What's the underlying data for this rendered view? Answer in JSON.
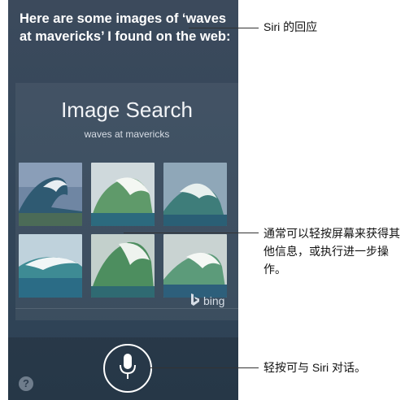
{
  "siri_response": "Here are some images of ‘waves at mavericks’ I found on the web:",
  "card": {
    "title": "Image Search",
    "query": "waves at mavericks",
    "provider": "bing"
  },
  "thumbnails": [
    {
      "name": "wave-image-1"
    },
    {
      "name": "wave-image-2"
    },
    {
      "name": "wave-image-3"
    },
    {
      "name": "wave-image-4"
    },
    {
      "name": "wave-image-5"
    },
    {
      "name": "wave-image-6"
    }
  ],
  "help_label": "?",
  "callouts": {
    "siri_response": "Siri 的回应",
    "tap_images": "通常可以轻按屏幕来获得其他信息，或执行进一步操作。",
    "tap_mic": "轻按可与 Siri 对话。"
  },
  "icons": {
    "mic": "microphone-icon",
    "help": "question-mark-icon",
    "bing": "bing-logo-icon"
  },
  "colors": {
    "screen_bg": "#34475a",
    "text": "#ffffff"
  }
}
